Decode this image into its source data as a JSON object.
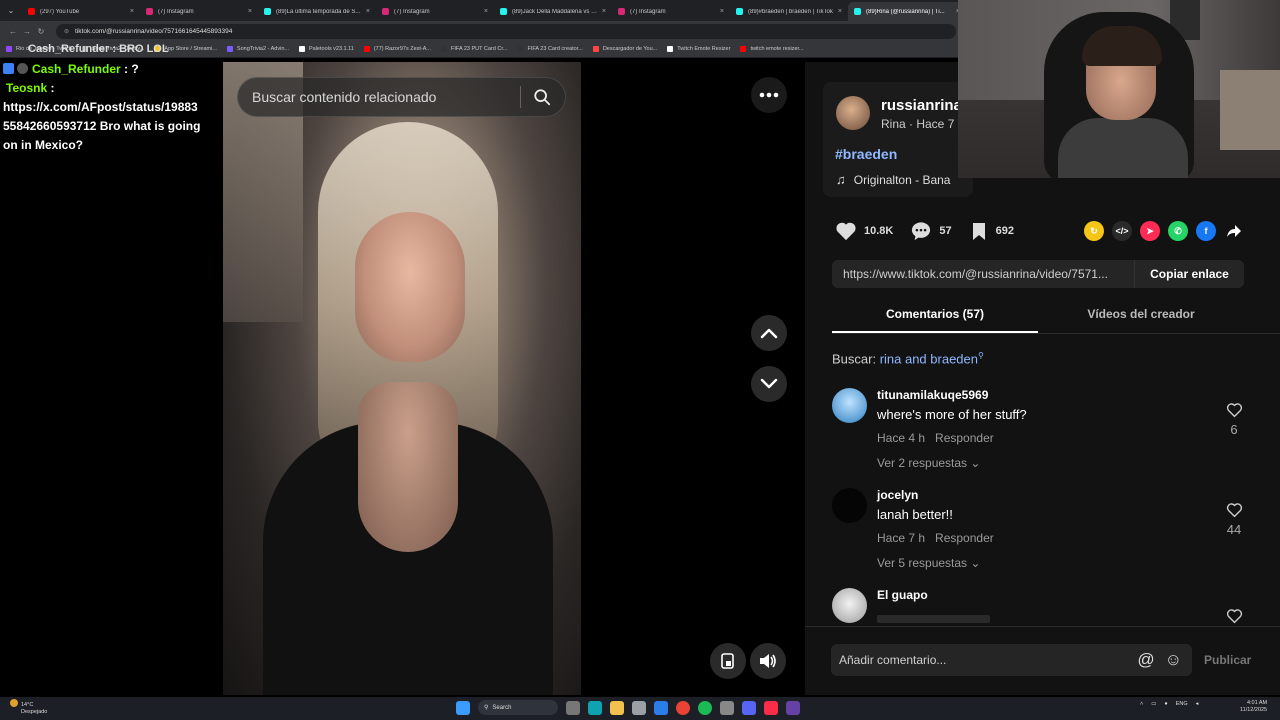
{
  "browser": {
    "tabs": [
      {
        "title": "(297) YouTube",
        "color": "#ff0000",
        "active": false
      },
      {
        "title": "(7) Instagram",
        "color": "#d62976",
        "active": false
      },
      {
        "title": "(89)La última temporada de S...",
        "color": "#25f4ee",
        "active": false
      },
      {
        "title": "(7) Instagram",
        "color": "#d62976",
        "active": false
      },
      {
        "title": "(89)Jack Della Maddalena vs Is...",
        "color": "#25f4ee",
        "active": false
      },
      {
        "title": "(7) Instagram",
        "color": "#d62976",
        "active": false
      },
      {
        "title": "(89)#braeden | braeden | TikTok",
        "color": "#25f4ee",
        "active": false
      },
      {
        "title": "(89)Rina (@russianrina) | Ti...",
        "color": "#25f4ee",
        "active": true
      }
    ],
    "url": "tiktok.com/@russianrina/video/7571661645445893394",
    "bookmarks": [
      {
        "label": "Rio de Janeiro - Twitch",
        "color": "#9146ff"
      },
      {
        "label": "SongTrivia2 - Test y...",
        "color": "#888888"
      },
      {
        "label": "App Store / Streami...",
        "color": "#f5c518"
      },
      {
        "label": "SongTrivia2 - Advin...",
        "color": "#7c5cff"
      },
      {
        "label": "Paletools v23.1.11",
        "color": "#ffffff"
      },
      {
        "label": "(77) Razor97s Zest-A...",
        "color": "#ff0000"
      },
      {
        "label": "FIFA 23 PUT Card Cr...",
        "color": "#333333"
      },
      {
        "label": "FIFA 23 Card creator...",
        "color": "#333333"
      },
      {
        "label": "Descargador de You...",
        "color": "#ff4444"
      },
      {
        "label": "Twitch Emote Resizer",
        "color": "#ffffff"
      },
      {
        "label": "twitch emote resizer...",
        "color": "#ff0000"
      }
    ]
  },
  "chat": {
    "top_line": "Cash_Refunder : BRO LOL",
    "messages": [
      {
        "user": "Cash_Refunder",
        "text": " : ?"
      },
      {
        "user": "Teosnk",
        "text": " :"
      }
    ],
    "body": "https://x.com/AFpost/status/19883 55842660593712 Bro what is going on in Mexico?"
  },
  "video": {
    "search_placeholder": "Buscar contenido relacionado"
  },
  "post": {
    "author": "russianrina",
    "subline": "Rina · Hace 7",
    "hashtag": "#braeden",
    "music": "Originalton - Bana",
    "likes": "10.8K",
    "comments": "57",
    "saves": "692",
    "share_icons": [
      {
        "name": "repost-icon",
        "color": "#f5c518",
        "glyph": "↻"
      },
      {
        "name": "embed-icon",
        "color": "#2a2a2a",
        "glyph": "</>"
      },
      {
        "name": "send-icon",
        "color": "#fe2c55",
        "glyph": "➤"
      },
      {
        "name": "whatsapp-icon",
        "color": "#25d366",
        "glyph": "✆"
      },
      {
        "name": "facebook-icon",
        "color": "#1877f2",
        "glyph": "f"
      }
    ],
    "link": "https://www.tiktok.com/@russianrina/video/7571...",
    "copy_label": "Copiar enlace"
  },
  "tabs": {
    "comments": "Comentarios (57)",
    "creator_videos": "Vídeos del creador"
  },
  "search_hint": {
    "prefix": "Buscar: ",
    "query": "rina and braeden"
  },
  "comments": [
    {
      "user": "titunamilakuqe5969",
      "text": "where's more of her stuff?",
      "time": "Hace 4 h",
      "reply": "Responder",
      "replies": "Ver 2 respuestas",
      "likes": "6",
      "avatar": "#2f7fc0"
    },
    {
      "user": "jocelyn",
      "text": "lanah better!!",
      "time": "Hace 7 h",
      "reply": "Responder",
      "replies": "Ver 5 respuestas",
      "likes": "44",
      "avatar": "#050505"
    },
    {
      "user": "El guapo",
      "text": "",
      "time": "",
      "reply": "",
      "replies": "",
      "likes": "",
      "avatar": "#d8d8d8"
    }
  ],
  "comment_box": {
    "placeholder": "Añadir comentario...",
    "publish": "Publicar"
  },
  "taskbar": {
    "temp": "14°C",
    "weather": "Despejado",
    "search": "Search",
    "lang": "ENG",
    "time": "4:01 AM",
    "date": "11/12/2025"
  }
}
